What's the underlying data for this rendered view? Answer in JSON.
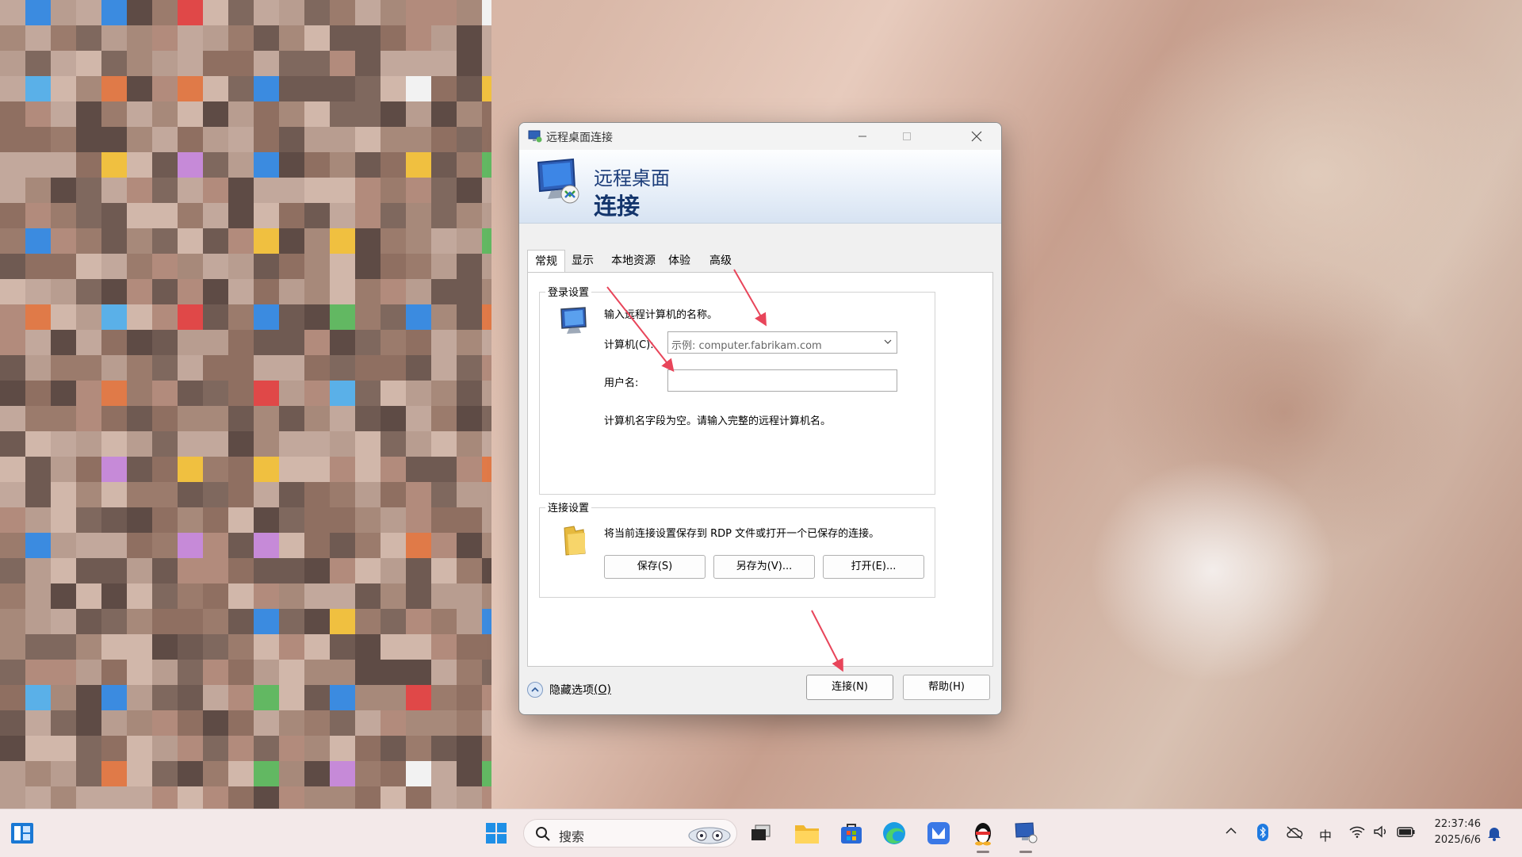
{
  "window": {
    "title": "远程桌面连接",
    "banner_line1": "远程桌面",
    "banner_line2": "连接"
  },
  "tabs": [
    {
      "label": "常规",
      "active": true
    },
    {
      "label": "显示"
    },
    {
      "label": "本地资源"
    },
    {
      "label": "体验"
    },
    {
      "label": "高级"
    }
  ],
  "login": {
    "group_label": "登录设置",
    "prompt": "输入远程计算机的名称。",
    "computer_label": "计算机(C):",
    "computer_value": "示例: computer.fabrikam.com",
    "username_label": "用户名:",
    "username_value": "",
    "hint": "计算机名字段为空。请输入完整的远程计算机名。"
  },
  "connection": {
    "group_label": "连接设置",
    "description": "将当前连接设置保存到 RDP 文件或打开一个已保存的连接。",
    "save_label": "保存(S)",
    "save_as_label": "另存为(V)...",
    "open_label": "打开(E)..."
  },
  "footer": {
    "hide_options_label": "隐藏选项",
    "hide_options_key": "(O)",
    "connect_label": "连接(N)",
    "help_label": "帮助(H)"
  },
  "taskbar": {
    "search_label": "搜索",
    "ime_label": "中",
    "time": "22:37:46",
    "date": "2025/6/6"
  },
  "colors": {
    "banner_text": "#14356c",
    "annotation_arrow": "#e8455a",
    "taskbar_bg": "#f3e9e9"
  }
}
